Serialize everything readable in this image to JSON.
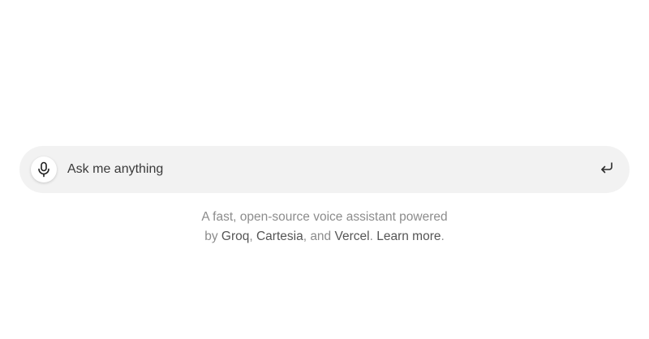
{
  "input": {
    "placeholder": "Ask me anything"
  },
  "icons": {
    "mic": "microphone-icon",
    "submit": "enter-return-icon"
  },
  "footer": {
    "line1": "A fast, open-source voice assistant powered",
    "by": "by",
    "link_groq": "Groq",
    "comma1": ",",
    "link_cartesia": "Cartesia",
    "and": ", and",
    "link_vercel": "Vercel",
    "period1": ".",
    "link_learn_more": "Learn more",
    "period2": "."
  },
  "colors": {
    "bar_background": "#f2f2f2",
    "muted_text": "#8c8c8c",
    "link_text": "#555555"
  }
}
